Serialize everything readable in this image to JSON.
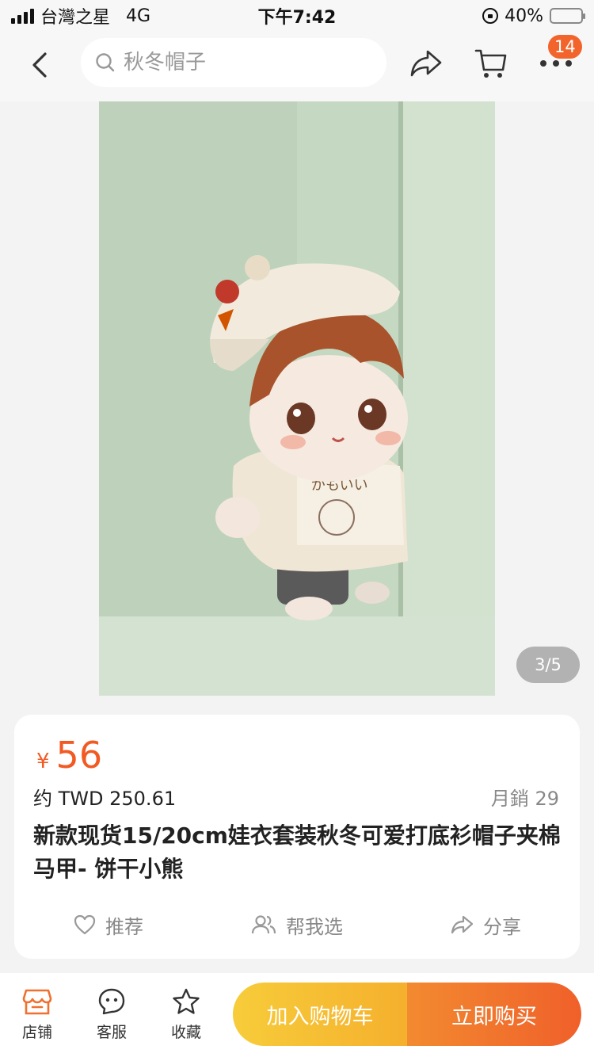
{
  "status_bar": {
    "carrier": "台灣之星",
    "network": "4G",
    "time": "下午7:42",
    "battery": "40%",
    "battery_level": 0.4
  },
  "nav": {
    "search_placeholder": "秋冬帽子",
    "cart_badge": "14",
    "icons": [
      "back-icon",
      "search-icon",
      "share-icon",
      "cart-icon",
      "more-icon"
    ]
  },
  "gallery": {
    "page_indicator": "3/5",
    "current_page": 3,
    "total_pages": 5,
    "bg_color": "#c5d7c3"
  },
  "product": {
    "currency_symbol": "¥",
    "price": "56",
    "converted_price": "约 TWD 250.61",
    "monthly_sales": "月銷 29",
    "title": "新款现货15/20cm娃衣套装秋冬可爱打底衫帽子夹棉马甲- 饼干小熊",
    "price_color": "#f25a24"
  },
  "actions": {
    "recommend": "推荐",
    "help_choose": "帮我选",
    "share": "分享"
  },
  "bottom": {
    "store": "店铺",
    "service": "客服",
    "favorite": "收藏",
    "add_to_cart": "加入购物车",
    "buy_now": "立即购买"
  }
}
